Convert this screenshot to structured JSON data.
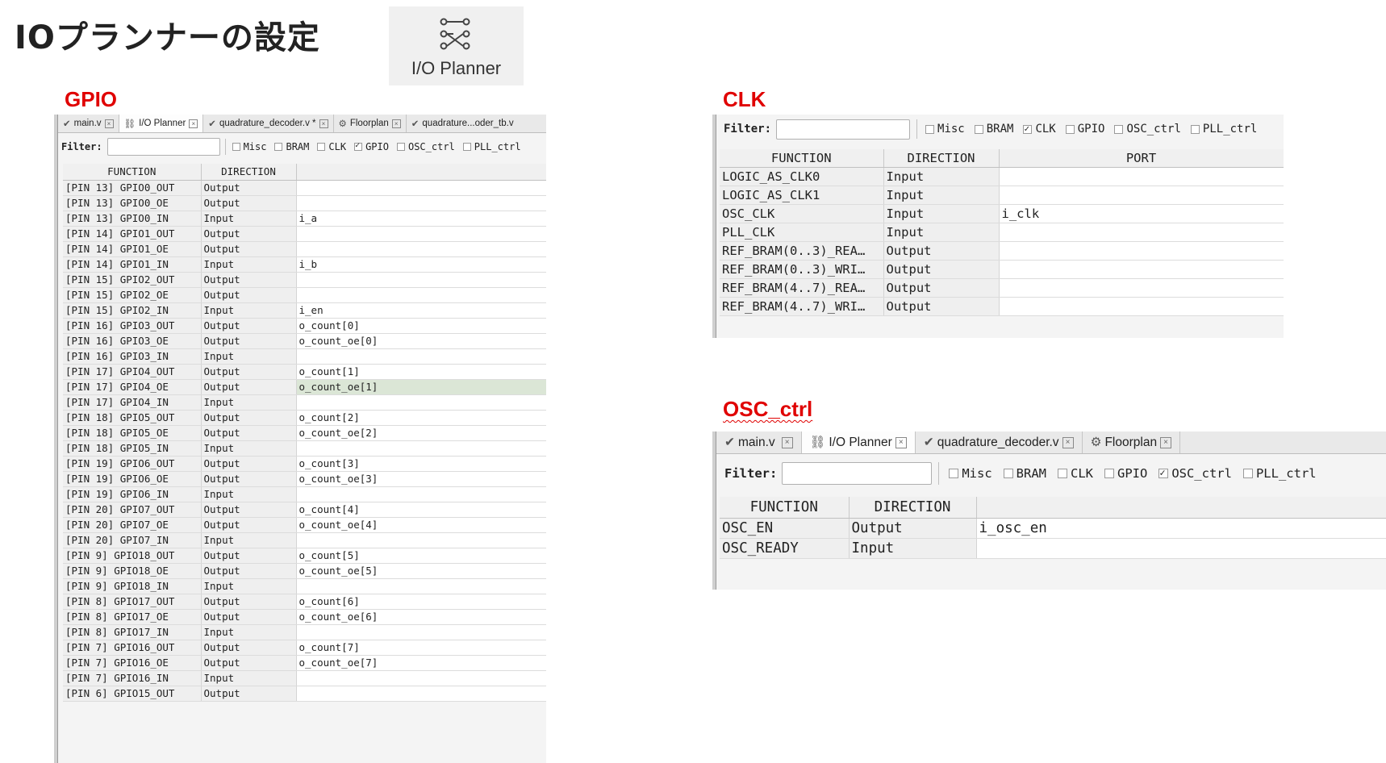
{
  "slide_title": "IOプランナーの設定",
  "toolbar_button": {
    "label": "I/O Planner"
  },
  "sections": {
    "gpio": "GPIO",
    "clk": "CLK",
    "osc": "OSC_ctrl"
  },
  "tabs": {
    "main": "main.v",
    "io_planner": "I/O Planner",
    "decoder_dirty": "quadrature_decoder.v *",
    "decoder": "quadrature_decoder.v",
    "floorplan": "Floorplan",
    "tb_truncated": "quadrature...oder_tb.v"
  },
  "filter": {
    "label": "Filter:",
    "value": ""
  },
  "checkbox_labels": {
    "misc": "Misc",
    "bram": "BRAM",
    "clk": "CLK",
    "gpio": "GPIO",
    "osc_ctrl": "OSC_ctrl",
    "pll_ctrl": "PLL_ctrl"
  },
  "columns": {
    "function": "FUNCTION",
    "direction": "DIRECTION",
    "port": "PORT"
  },
  "gpio_panel": {
    "checked": "gpio",
    "rows": [
      {
        "function": "[PIN 13] GPIO0_OUT",
        "direction": "Output",
        "port": ""
      },
      {
        "function": "[PIN 13] GPIO0_OE",
        "direction": "Output",
        "port": ""
      },
      {
        "function": "[PIN 13] GPIO0_IN",
        "direction": "Input",
        "port": "i_a"
      },
      {
        "function": "[PIN 14] GPIO1_OUT",
        "direction": "Output",
        "port": ""
      },
      {
        "function": "[PIN 14] GPIO1_OE",
        "direction": "Output",
        "port": ""
      },
      {
        "function": "[PIN 14] GPIO1_IN",
        "direction": "Input",
        "port": "i_b"
      },
      {
        "function": "[PIN 15] GPIO2_OUT",
        "direction": "Output",
        "port": ""
      },
      {
        "function": "[PIN 15] GPIO2_OE",
        "direction": "Output",
        "port": ""
      },
      {
        "function": "[PIN 15] GPIO2_IN",
        "direction": "Input",
        "port": "i_en"
      },
      {
        "function": "[PIN 16] GPIO3_OUT",
        "direction": "Output",
        "port": "o_count[0]"
      },
      {
        "function": "[PIN 16] GPIO3_OE",
        "direction": "Output",
        "port": "o_count_oe[0]"
      },
      {
        "function": "[PIN 16] GPIO3_IN",
        "direction": "Input",
        "port": ""
      },
      {
        "function": "[PIN 17] GPIO4_OUT",
        "direction": "Output",
        "port": "o_count[1]"
      },
      {
        "function": "[PIN 17] GPIO4_OE",
        "direction": "Output",
        "port": "o_count_oe[1]",
        "selected": true
      },
      {
        "function": "[PIN 17] GPIO4_IN",
        "direction": "Input",
        "port": ""
      },
      {
        "function": "[PIN 18] GPIO5_OUT",
        "direction": "Output",
        "port": "o_count[2]"
      },
      {
        "function": "[PIN 18] GPIO5_OE",
        "direction": "Output",
        "port": "o_count_oe[2]"
      },
      {
        "function": "[PIN 18] GPIO5_IN",
        "direction": "Input",
        "port": ""
      },
      {
        "function": "[PIN 19] GPIO6_OUT",
        "direction": "Output",
        "port": "o_count[3]"
      },
      {
        "function": "[PIN 19] GPIO6_OE",
        "direction": "Output",
        "port": "o_count_oe[3]"
      },
      {
        "function": "[PIN 19] GPIO6_IN",
        "direction": "Input",
        "port": ""
      },
      {
        "function": "[PIN 20] GPIO7_OUT",
        "direction": "Output",
        "port": "o_count[4]"
      },
      {
        "function": "[PIN 20] GPIO7_OE",
        "direction": "Output",
        "port": "o_count_oe[4]"
      },
      {
        "function": "[PIN 20] GPIO7_IN",
        "direction": "Input",
        "port": ""
      },
      {
        "function": "[PIN  9] GPIO18_OUT",
        "direction": "Output",
        "port": "o_count[5]"
      },
      {
        "function": "[PIN  9] GPIO18_OE",
        "direction": "Output",
        "port": "o_count_oe[5]"
      },
      {
        "function": "[PIN  9] GPIO18_IN",
        "direction": "Input",
        "port": ""
      },
      {
        "function": "[PIN  8] GPIO17_OUT",
        "direction": "Output",
        "port": "o_count[6]"
      },
      {
        "function": "[PIN  8] GPIO17_OE",
        "direction": "Output",
        "port": "o_count_oe[6]"
      },
      {
        "function": "[PIN  8] GPIO17_IN",
        "direction": "Input",
        "port": ""
      },
      {
        "function": "[PIN  7] GPIO16_OUT",
        "direction": "Output",
        "port": "o_count[7]"
      },
      {
        "function": "[PIN  7] GPIO16_OE",
        "direction": "Output",
        "port": "o_count_oe[7]"
      },
      {
        "function": "[PIN  7] GPIO16_IN",
        "direction": "Input",
        "port": ""
      },
      {
        "function": "[PIN  6] GPIO15_OUT",
        "direction": "Output",
        "port": ""
      }
    ]
  },
  "clk_panel": {
    "checked": "clk",
    "rows": [
      {
        "function": "LOGIC_AS_CLK0",
        "direction": "Input",
        "port": ""
      },
      {
        "function": "LOGIC_AS_CLK1",
        "direction": "Input",
        "port": ""
      },
      {
        "function": "OSC_CLK",
        "direction": "Input",
        "port": "i_clk"
      },
      {
        "function": "PLL_CLK",
        "direction": "Input",
        "port": ""
      },
      {
        "function": "REF_BRAM(0..3)_REA…",
        "direction": "Output",
        "port": ""
      },
      {
        "function": "REF_BRAM(0..3)_WRI…",
        "direction": "Output",
        "port": ""
      },
      {
        "function": "REF_BRAM(4..7)_REA…",
        "direction": "Output",
        "port": ""
      },
      {
        "function": "REF_BRAM(4..7)_WRI…",
        "direction": "Output",
        "port": ""
      }
    ]
  },
  "osc_panel": {
    "checked": "osc_ctrl",
    "rows": [
      {
        "function": "OSC_EN",
        "direction": "Output",
        "port": "i_osc_en"
      },
      {
        "function": "OSC_READY",
        "direction": "Input",
        "port": ""
      }
    ]
  }
}
